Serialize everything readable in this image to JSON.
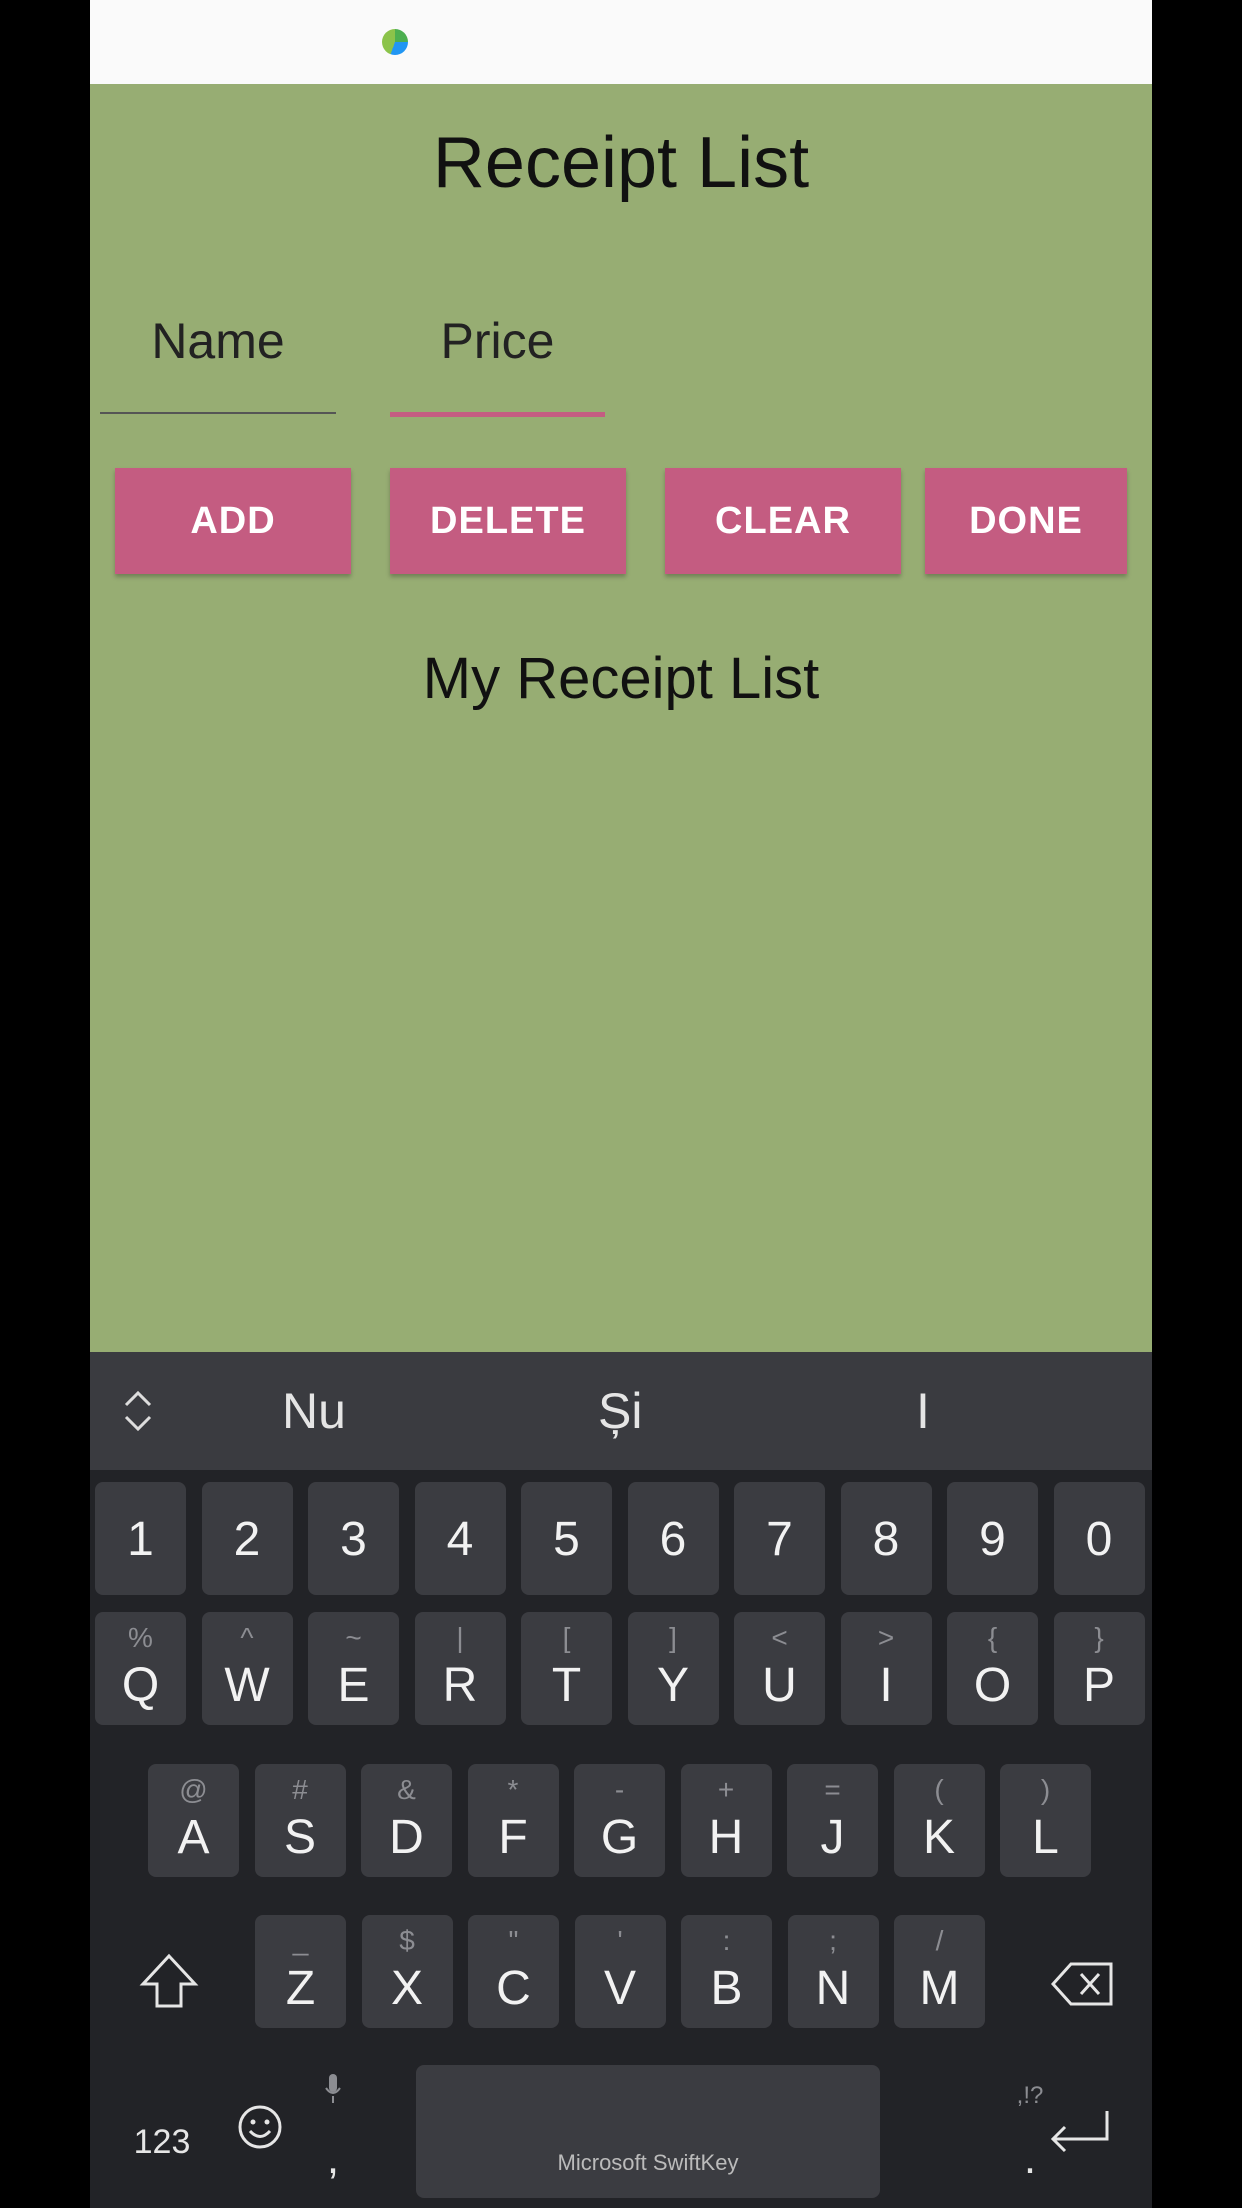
{
  "app": {
    "title": "Receipt List",
    "name_placeholder": "Name",
    "price_placeholder": "Price",
    "buttons": {
      "add": "ADD",
      "delete": "DELETE",
      "clear": "CLEAR",
      "done": "DONE"
    },
    "list_title": "My Receipt List"
  },
  "keyboard": {
    "brand": "Microsoft SwiftKey",
    "suggestions": [
      "Nu",
      "Și",
      "I"
    ],
    "number_row": [
      "1",
      "2",
      "3",
      "4",
      "5",
      "6",
      "7",
      "8",
      "9",
      "0"
    ],
    "row1": [
      {
        "k": "Q",
        "s": "%"
      },
      {
        "k": "W",
        "s": "^"
      },
      {
        "k": "E",
        "s": "~"
      },
      {
        "k": "R",
        "s": "|"
      },
      {
        "k": "T",
        "s": "["
      },
      {
        "k": "Y",
        "s": "]"
      },
      {
        "k": "U",
        "s": "<"
      },
      {
        "k": "I",
        "s": ">"
      },
      {
        "k": "O",
        "s": "{"
      },
      {
        "k": "P",
        "s": "}"
      }
    ],
    "row2": [
      {
        "k": "A",
        "s": "@"
      },
      {
        "k": "S",
        "s": "#"
      },
      {
        "k": "D",
        "s": "&"
      },
      {
        "k": "F",
        "s": "*"
      },
      {
        "k": "G",
        "s": "-"
      },
      {
        "k": "H",
        "s": "+"
      },
      {
        "k": "J",
        "s": "="
      },
      {
        "k": "K",
        "s": "("
      },
      {
        "k": "L",
        "s": ")"
      }
    ],
    "row3": [
      {
        "k": "Z",
        "s": "_"
      },
      {
        "k": "X",
        "s": "$"
      },
      {
        "k": "C",
        "s": "\""
      },
      {
        "k": "V",
        "s": "'"
      },
      {
        "k": "B",
        "s": ":"
      },
      {
        "k": "N",
        "s": ";"
      },
      {
        "k": "M",
        "s": "/"
      }
    ],
    "numbers_key": "123",
    "comma_key": ",",
    "period_key": ".",
    "period_sub": ",!?",
    "shift_icon": "shift-icon",
    "backspace_icon": "backspace-icon",
    "enter_icon": "enter-icon",
    "emoji_icon": "emoji-icon",
    "mic_icon": "mic-icon"
  }
}
